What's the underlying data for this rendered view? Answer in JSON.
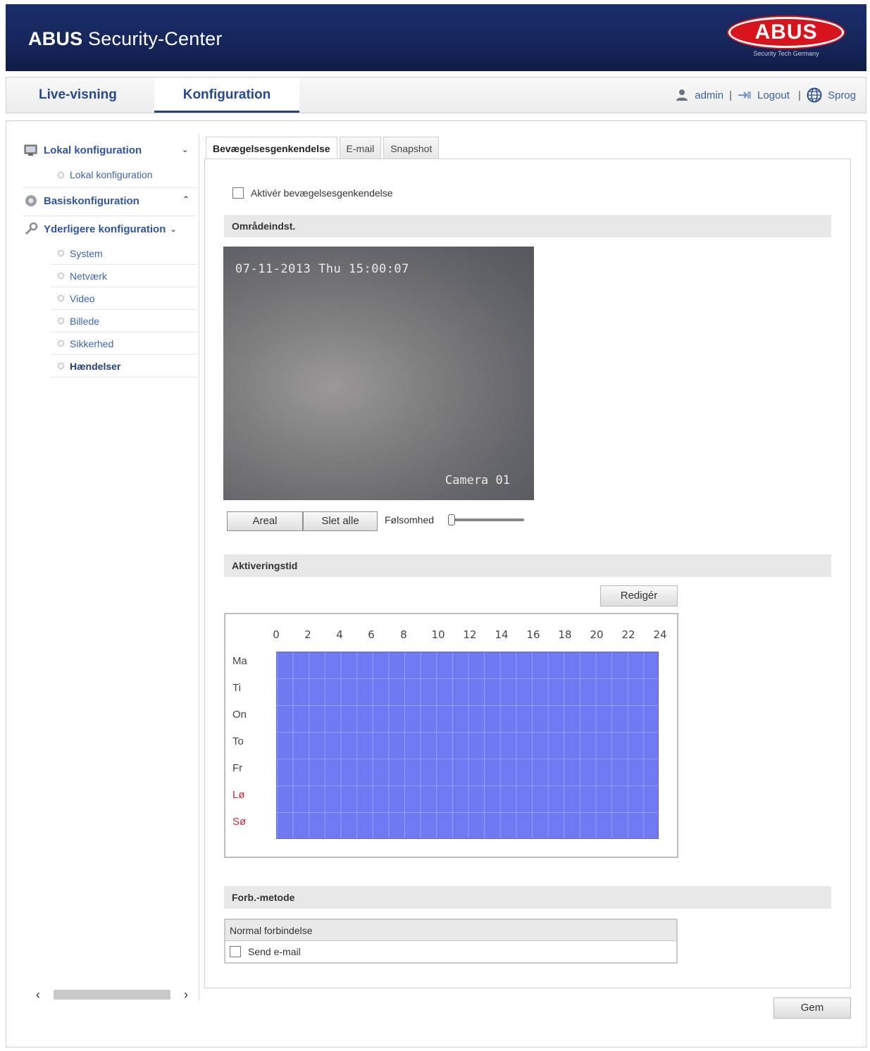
{
  "header": {
    "app_title_bold": "ABUS",
    "app_title_rest": "Security-Center",
    "logo_text": "ABUS",
    "logo_subtext": "Security Tech Germany",
    "brand_color": "#16275c",
    "logo_color": "#d7141b"
  },
  "topnav": {
    "tabs": [
      {
        "label": "Live-visning"
      },
      {
        "label": "Konfiguration"
      }
    ],
    "user": "admin",
    "logout": "Logout",
    "language": "Sprog"
  },
  "sidebar": {
    "local_section": "Lokal konfiguration",
    "local_items": [
      "Lokal konfiguration"
    ],
    "basic_section": "Basiskonfiguration",
    "advanced_section": "Yderligere konfiguration",
    "advanced_items": [
      "System",
      "Netværk",
      "Video",
      "Billede",
      "Sikkerhed",
      "Hændelser"
    ],
    "active_item": "Hændelser"
  },
  "content": {
    "tabs": [
      "Bevægelsesgenkendelse",
      "E-mail",
      "Snapshot"
    ],
    "enable_label": "Aktivér bevægelsesgenkendelse",
    "area_section": "Områdeindst.",
    "camera": {
      "timestamp": "07-11-2013 Thu 15:00:07",
      "name": "Camera 01"
    },
    "area_button": "Areal",
    "delete_all_button": "Slet alle",
    "sensitivity_label": "Følsomhed",
    "sensitivity_value": 0,
    "activation_section": "Aktiveringstid",
    "edit_button": "Redigér",
    "schedule": {
      "hours": [
        "0",
        "2",
        "4",
        "6",
        "8",
        "10",
        "12",
        "14",
        "16",
        "18",
        "20",
        "22",
        "24"
      ],
      "days": [
        "Ma",
        "Ti",
        "On",
        "To",
        "Fr",
        "Lø",
        "Sø"
      ],
      "weekend_color": "#c8283c",
      "fill_color": "#6f79f2"
    },
    "linkage_section": "Forb.-metode",
    "linkage_header": "Normal forbindelse",
    "send_email_label": "Send e-mail",
    "save_button": "Gem"
  }
}
